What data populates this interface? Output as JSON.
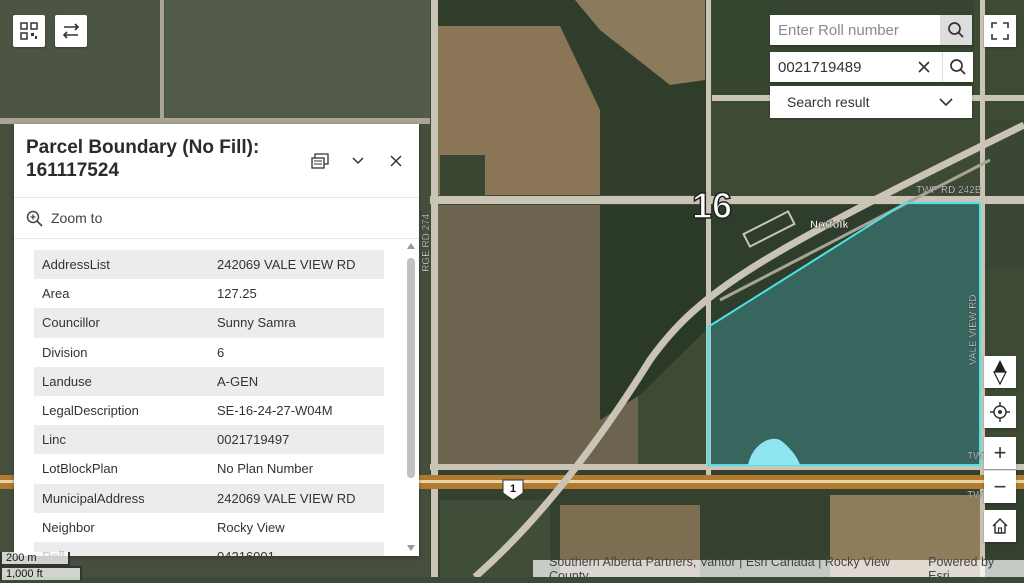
{
  "toolbar": {
    "qr_icon": "qr-code-icon",
    "swap_icon": "swap-arrows-icon"
  },
  "search": {
    "roll_placeholder": "Enter Roll number",
    "linc_value": "0021719489",
    "result_label": "Search result"
  },
  "map": {
    "section_label": "16",
    "place_label": "Norfolk",
    "road_labels": {
      "twp_rd_top": "TWP RD 242B",
      "rge_rd": "RGE RD 274",
      "vale_view": "VALE VIEW RD",
      "highway": "1",
      "right_edge_1": "TWP",
      "right_edge_2": "TWP",
      "right_edge_3": "15"
    },
    "colors": {
      "parcel_outline": "#4fe0ea",
      "parcel_fill": "rgba(80,210,225,0.28)",
      "pond": "#8fe6f2",
      "road": "#c9c4b5",
      "highway": "#b27a2e"
    }
  },
  "popup": {
    "title": "Parcel Boundary (No Fill): 161117524",
    "dock_icon": "dock-icon",
    "collapse_icon": "chevron-down-icon",
    "close_icon": "close-icon",
    "zoom_label": "Zoom to",
    "attributes": [
      {
        "key": "AddressList",
        "value": "242069 VALE VIEW RD"
      },
      {
        "key": "Area",
        "value": "127.25"
      },
      {
        "key": "Councillor",
        "value": "Sunny Samra"
      },
      {
        "key": "Division",
        "value": "6"
      },
      {
        "key": "Landuse",
        "value": "A-GEN"
      },
      {
        "key": "LegalDescription",
        "value": "SE-16-24-27-W04M"
      },
      {
        "key": "Linc",
        "value": "0021719497"
      },
      {
        "key": "LotBlockPlan",
        "value": "No Plan Number"
      },
      {
        "key": "MunicipalAddress",
        "value": "242069 VALE VIEW RD"
      },
      {
        "key": "Neighbor",
        "value": "Rocky View"
      },
      {
        "key": "Roll",
        "value": "04216001"
      }
    ]
  },
  "controls": {
    "compass_icon": "compass-icon",
    "locate_icon": "locate-icon",
    "zoom_in": "+",
    "zoom_out": "−",
    "home_icon": "home-icon",
    "fullscreen_icon": "fullscreen-icon"
  },
  "attribution": {
    "sources": "Southern Alberta Partners, Vantor | Esri Canada | Rocky View County",
    "powered_by": "Powered by Esri"
  },
  "scale": {
    "metric": "200 m",
    "imperial": "1,000 ft"
  }
}
